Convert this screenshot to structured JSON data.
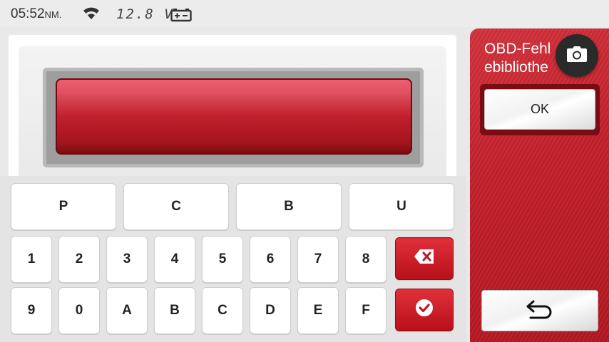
{
  "status_bar": {
    "time": "05:52",
    "ampm": "NM.",
    "voltage": "12.8 V",
    "wifi_icon": "wifi-icon",
    "battery_icon": "car-battery-icon"
  },
  "keyboard": {
    "letter_keys": [
      "P",
      "C",
      "B",
      "U"
    ],
    "row1": [
      "1",
      "2",
      "3",
      "4",
      "5",
      "6",
      "7",
      "8"
    ],
    "row2": [
      "9",
      "0",
      "A",
      "B",
      "C",
      "D",
      "E",
      "F"
    ],
    "backspace_icon": "backspace-icon",
    "confirm_icon": "check-icon"
  },
  "right_panel": {
    "title": "OBD-Fehlercodebibliothek",
    "title_visible": "OBD-Fehl    \nebibliothe",
    "ok_label": "OK",
    "back_icon": "back-arrow-icon",
    "camera_icon": "camera-icon"
  },
  "colors": {
    "accent_red": "#c21f29",
    "display_red": "#c0202c"
  }
}
